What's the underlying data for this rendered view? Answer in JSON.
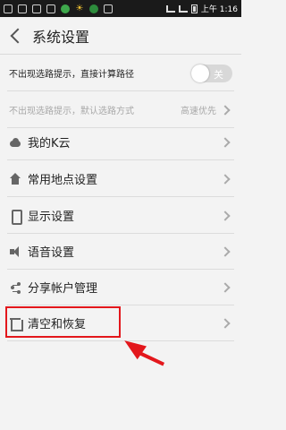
{
  "status_bar": {
    "time": "上午 1:16",
    "icons": [
      "android-icon",
      "image-icon",
      "mail-icon",
      "download-icon",
      "app-icon",
      "sun-icon",
      "leaf-icon",
      "puzzle-icon",
      "wifi-icon",
      "signal-icon",
      "battery-icon"
    ]
  },
  "header": {
    "title": "系统设置",
    "back_icon": "back-arrow-icon"
  },
  "settings": {
    "direct_route": {
      "label": "不出现选路提示，直接计算路径",
      "toggle_label": "关",
      "toggle_state": "off"
    },
    "default_route": {
      "label": "不出现选路提示，默认选路方式",
      "value": "高速优先",
      "enabled": false
    }
  },
  "menu": [
    {
      "label": "我的K云",
      "icon": "cloud-icon"
    },
    {
      "label": "常用地点设置",
      "icon": "home-icon"
    },
    {
      "label": "显示设置",
      "icon": "phone-icon"
    },
    {
      "label": "语音设置",
      "icon": "speaker-icon"
    },
    {
      "label": "分享帐户管理",
      "icon": "share-icon"
    },
    {
      "label": "清空和恢复",
      "icon": "trash-icon"
    }
  ],
  "colors": {
    "annotation": "#e3171c",
    "background": "#f3f3f3",
    "status_bar": "#1a1a1a"
  }
}
